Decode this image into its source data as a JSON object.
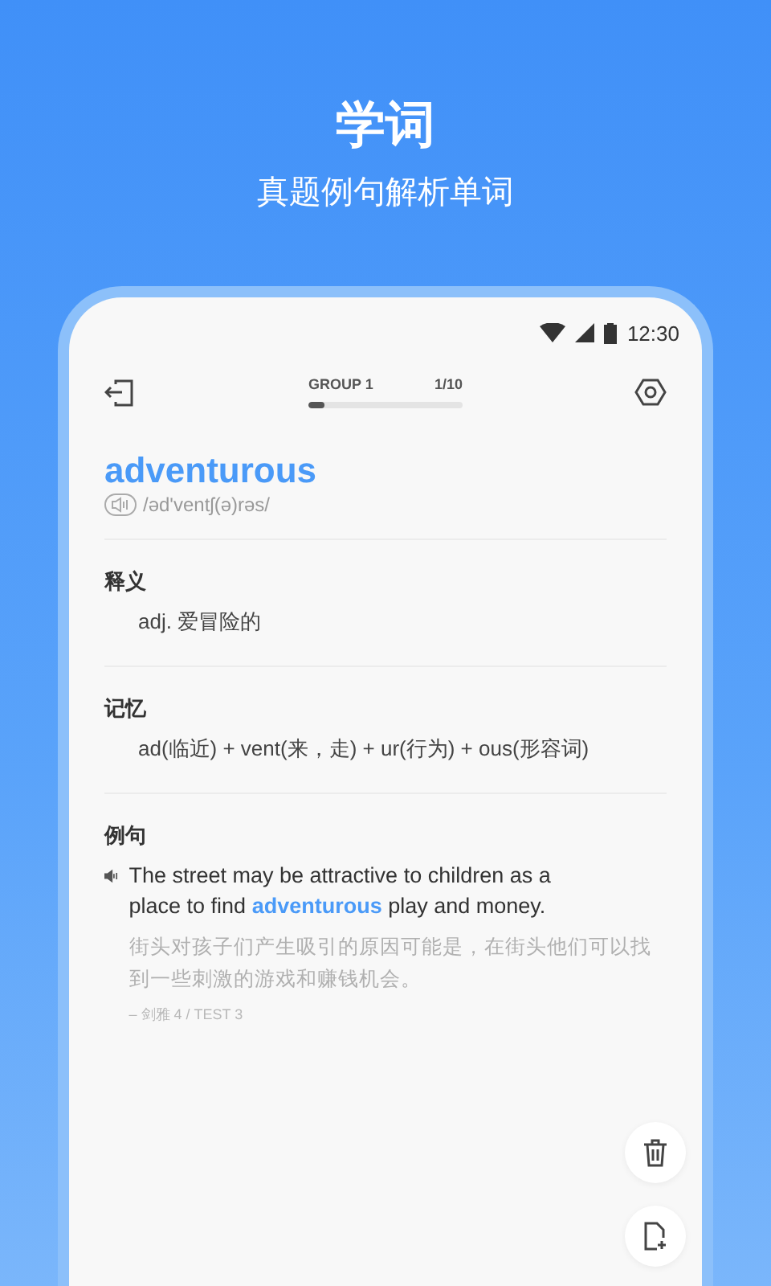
{
  "promo": {
    "title": "学词",
    "subtitle": "真题例句解析单词"
  },
  "status_bar": {
    "time": "12:30"
  },
  "header": {
    "group": "GROUP 1",
    "count": "1/10",
    "level": 0.1
  },
  "word": {
    "text": "adventurous",
    "phonetic": "/əd'ventʃ(ə)rəs/"
  },
  "sections": [
    {
      "kind": "text",
      "title": "释义",
      "body": "adj. 爱冒险的"
    },
    {
      "kind": "text",
      "title": "记忆",
      "body": "ad(临近) + vent(来，走) + ur(行为) + ous(形容词)"
    },
    {
      "kind": "example",
      "title": "例句",
      "sentence": "The street may be attractive to children as a place to find **adventurous** play and money.",
      "translation": "街头对孩子们产生吸引的原因可能是，在街头他们可以找到一些刺激的游戏和赚钱机会。",
      "source": "– 剑雅 4 / TEST 3"
    }
  ]
}
